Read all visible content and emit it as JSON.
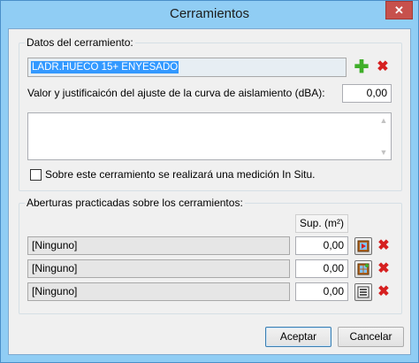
{
  "window": {
    "title": "Cerramientos"
  },
  "enclosure": {
    "group_label": "Datos del cerramiento:",
    "selected_value": "LADR.HUECO 15+ ENYESADO",
    "adjust_label": "Valor y justificaicón del ajuste de la curva de aislamiento (dBA):",
    "adjust_value": "0,00",
    "justification_text": "",
    "insitu_label": "Sobre este cerramiento se realizará una medición In Situ.",
    "insitu_checked": false
  },
  "openings": {
    "group_label": "Aberturas practicadas sobre los cerramientos:",
    "column_header": "Sup. (m²)",
    "rows": [
      {
        "name": "[Ninguno]",
        "area": "0,00",
        "tool_icon": "window-edit-icon"
      },
      {
        "name": "[Ninguno]",
        "area": "0,00",
        "tool_icon": "window-grid-icon"
      },
      {
        "name": "[Ninguno]",
        "area": "0,00",
        "tool_icon": "list-icon"
      }
    ]
  },
  "buttons": {
    "accept": "Aceptar",
    "cancel": "Cancelar"
  },
  "colors": {
    "titlebar": "#90cdf4",
    "close": "#c7514c",
    "selection": "#3399ff",
    "add": "#3fae29",
    "delete": "#d62020"
  }
}
